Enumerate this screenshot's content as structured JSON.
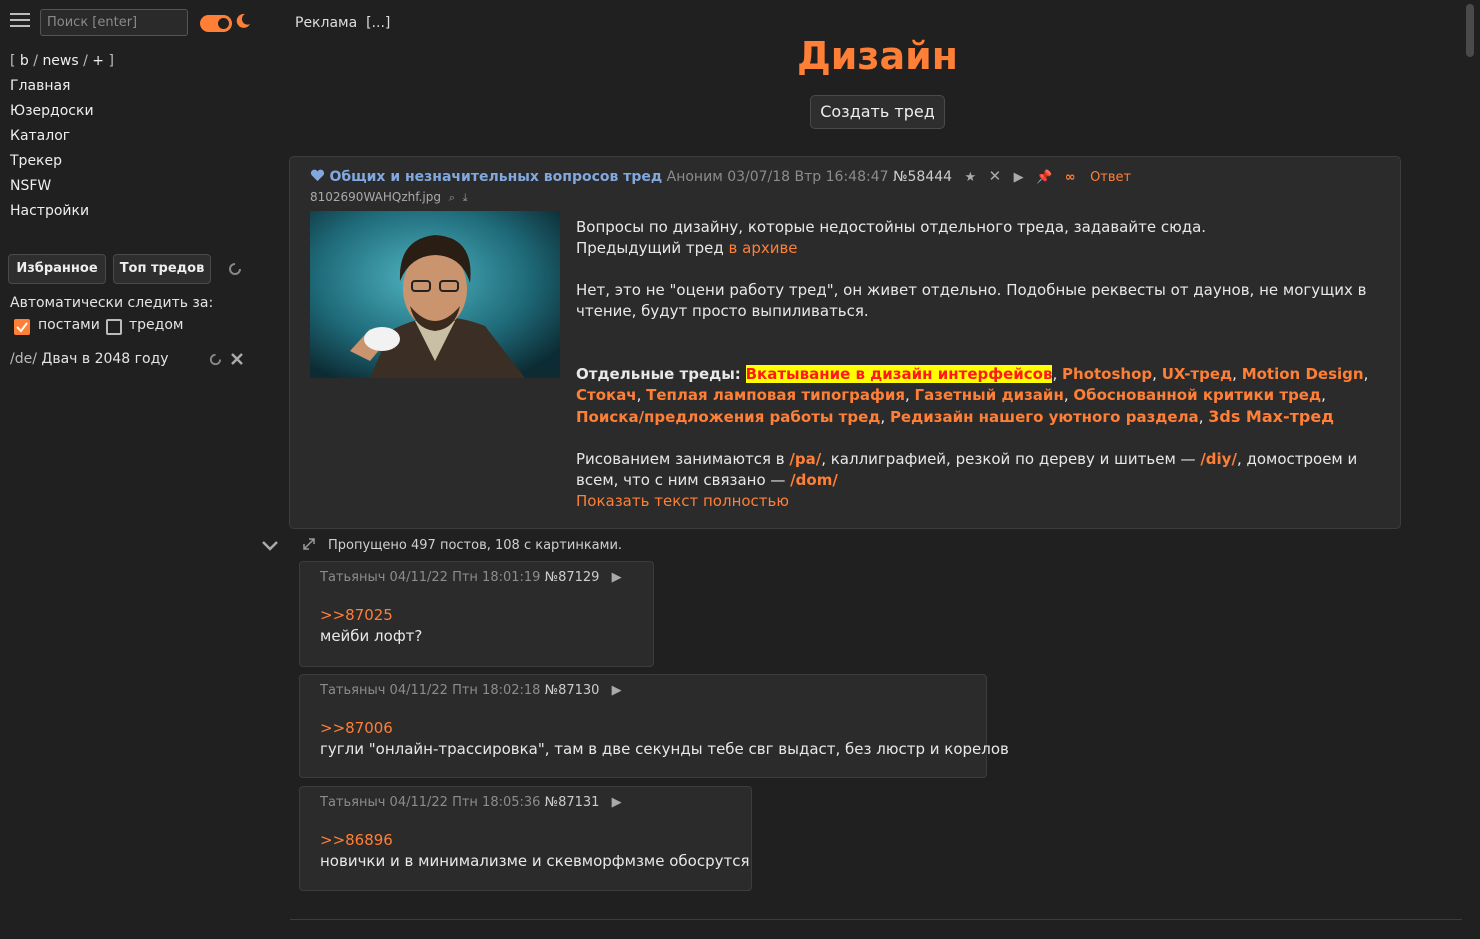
{
  "sidebar": {
    "search_placeholder": "Поиск [enter]",
    "boards_open": "[",
    "boards_b": "b",
    "boards_sep": "/",
    "boards_news": "news",
    "boards_plus": "+",
    "boards_close": "]",
    "nav": [
      "Главная",
      "Юзердоски",
      "Каталог",
      "Трекер",
      "NSFW",
      "Настройки"
    ],
    "favorites_label": "Избранное",
    "top_threads_label": "Топ тредов",
    "auto_follow_label": "Автоматически следить за:",
    "posts_label": "постами",
    "thread_label": "тредом",
    "fav_board": "/de/",
    "fav_thread": "Двач в 2048 году"
  },
  "header": {
    "ad_label": "Реклама",
    "ad_more": "[...]",
    "board_title": "Дизайн",
    "create_thread_label": "Создать тред"
  },
  "op": {
    "subject": "Общих и незначительных вопросов тред",
    "author": "Аноним",
    "date": "03/07/18 Втр 16:48:47",
    "number": "№58444",
    "reply_label": "Ответ",
    "filename": "8102690WAHQzhf.jpg",
    "line1": "Вопросы по дизайну, которые недостойны отдельного треда, задавайте сюда.",
    "line2_pre": "Предыдущий тред ",
    "line2_link": "в архиве",
    "line3": "Нет, это не \"оцени работу тред\", он живет отдельно. Подобные реквесты от даунов, не могущих в чтение, будут просто выпиливаться.",
    "separate_label": "Отдельные треды:",
    "link_highlight": "Вкатывание в дизайн интерфейсов",
    "links": [
      "Photoshop",
      "UX-тред",
      "Motion Design",
      "Стокач",
      "Теплая ламповая типография",
      "Газетный дизайн",
      "Обоснованной критики тред",
      "Поиска/предложения работы тред",
      "Редизайн нашего уютного раздела",
      "3ds Max-тред"
    ],
    "drawing_pre": "Рисованием занимаются в ",
    "drawing_pa": "/pa/",
    "drawing_mid": ", каллиграфией, резкой по дереву и шитьем — ",
    "drawing_diy": "/diy/",
    "drawing_mid2": ", домостроем и всем, что с ним связано — ",
    "drawing_dom": "/dom/",
    "show_full": "Показать текст полностью"
  },
  "skipped": "Пропущено 497 постов, 108 с картинками.",
  "posts": [
    {
      "author": "Татьяныч",
      "date": "04/11/22 Птн 18:01:19",
      "number": "№87129",
      "ref": ">>87025",
      "text": "мейби лофт?"
    },
    {
      "author": "Татьяныч",
      "date": "04/11/22 Птн 18:02:18",
      "number": "№87130",
      "ref": ">>87006",
      "text": "гугли \"онлайн-трассировка\", там в две секунды тебе свг выдаст, без люстр и корелов"
    },
    {
      "author": "Татьяныч",
      "date": "04/11/22 Птн 18:05:36",
      "number": "№87131",
      "ref": ">>86896",
      "text": "новички и в минимализме и скевморфмзме обосрутся"
    }
  ],
  "colors": {
    "accent": "#ff7f36",
    "background": "#202020",
    "panel": "#2b2b2b",
    "subject": "#82a8e0",
    "highlight": "#ffff00"
  }
}
